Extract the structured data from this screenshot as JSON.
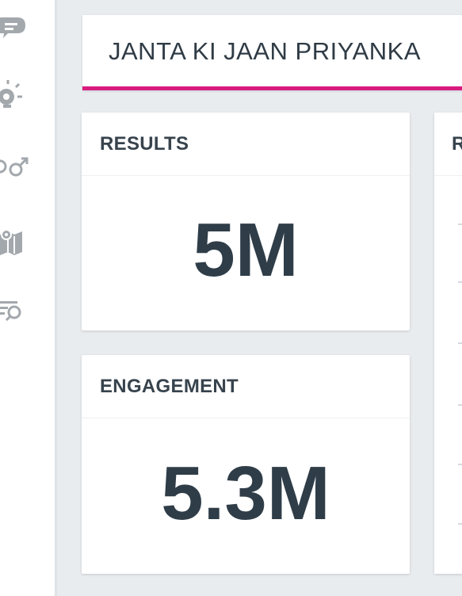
{
  "sidebar": {
    "icons": [
      "chat-bubble-icon",
      "bulb-icon",
      "gender-icon",
      "map-icon",
      "filter-list-icon"
    ]
  },
  "header": {
    "title": "JANTA KI JAAN PRIYANKA",
    "accent_color": "#d81b7e"
  },
  "cards": {
    "results": {
      "label": "RESULTS",
      "value": "5M"
    },
    "engagement": {
      "label": "ENGAGEMENT",
      "value": "5.3M"
    },
    "right_partial": {
      "label": "R"
    }
  }
}
